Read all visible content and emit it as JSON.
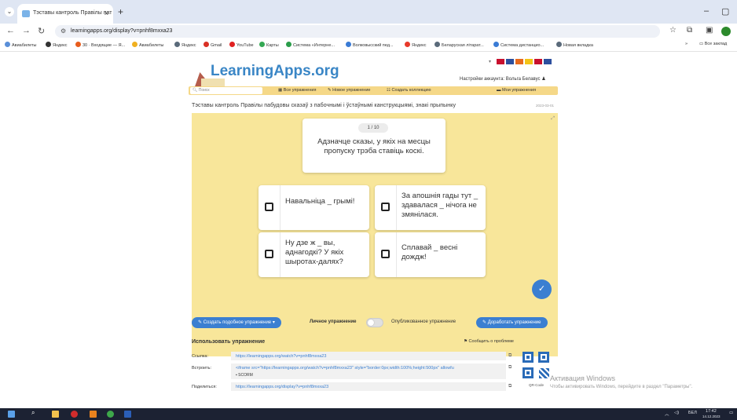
{
  "browser": {
    "tab_title": "Тэставы кантроль Правілы пат",
    "tab_close": "×",
    "new_tab": "+",
    "url": "learningapps.org/display?v=pnhf8mxxa23",
    "window_controls": {
      "minimize": "–",
      "maximize": "▢"
    },
    "bookmarks": [
      {
        "label": "Авиабилеты",
        "color": "#5a8fd8"
      },
      {
        "label": "Яндекс",
        "color": "#333333"
      },
      {
        "label": "30 · Входящие — Я...",
        "color": "#e85d1d"
      },
      {
        "label": "Авиабилеты",
        "color": "#f0b020"
      },
      {
        "label": "Яндекс",
        "color": "#5a6a7a"
      },
      {
        "label": "Gmail",
        "color": "#d93025"
      },
      {
        "label": "YouTube",
        "color": "#e02020"
      },
      {
        "label": "Карты",
        "color": "#34a853"
      },
      {
        "label": "Система «Интерне...",
        "color": "#2a9d4a"
      },
      {
        "label": "Волковысский пед...",
        "color": "#3a7bd5"
      },
      {
        "label": "Яндекс",
        "color": "#e83a2a"
      },
      {
        "label": "Беларуская літарат...",
        "color": "#5a6a7a"
      },
      {
        "label": "Система дистанцио...",
        "color": "#3a7bd5"
      },
      {
        "label": "Новая вкладка",
        "color": "#5a6a7a"
      }
    ],
    "bookmarks_more": "»",
    "all_bookmarks": "Все заклад"
  },
  "site": {
    "logo": "LearningApps.org",
    "account_label": "Настройки аккаунта: Вольга Белавус",
    "search_placeholder": "Поиск",
    "menu": {
      "all_exercises": "Все упражнения",
      "new_exercise": "Новое упражнение",
      "create_collection": "Создать коллекцию",
      "my_exercises": "Мои упражнения"
    },
    "exercise_title": "Тэставы кантроль Правілы пабудовы сказаў з пабочнымі і ўстаўнымі канструкцыямі, знакі прыпынку",
    "date": "2023-03-01"
  },
  "exercise": {
    "counter": "1 / 10",
    "question": "Адзначце сказы, у якіх на месцы пропуску трэба ставіць коскі.",
    "options": [
      "Навальніца _ грымі!",
      "За апошнія гады тут _ здавалася _ нічога не змянілася.",
      "Ну дзе ж _ вы, аднагодкі? У якіх шыротах-далях?",
      "Сплавай _ весні дождж!"
    ]
  },
  "actions": {
    "create_similar": "Создать подобное упражнение",
    "private_label": "Личное упражнение",
    "published_label": "Опубликованное упражнение",
    "improve": "Доработать упражнение"
  },
  "use_section": {
    "heading": "Использовать упражнение",
    "report": "Сообщить о проблеме",
    "rows": [
      {
        "key": "Ссылка:",
        "value": "https://learningapps.org/watch?v=pnhf8mxxa23"
      },
      {
        "key": "Встроить:",
        "value": "<iframe src=\"https://learningapps.org/watch?v=pnhf8mxxa23\" style=\"border:0px;width:100%;height:500px\" allowfu"
      },
      {
        "key": "Поделиться:",
        "value": "https://learningapps.org/display?v=pnhf8mxxa23"
      }
    ],
    "embed_sub": "SCORM",
    "qr_label": "QR-Code"
  },
  "watermark": {
    "line1": "Активация Windows",
    "line2": "Чтобы активировать Windows, перейдите в раздел \"Параметры\"."
  },
  "taskbar": {
    "lang": "БЕЛ",
    "time": "17:42",
    "date": "14.12.2023"
  }
}
